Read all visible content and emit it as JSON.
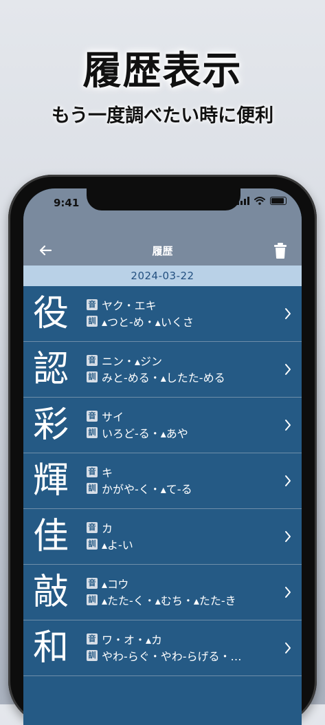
{
  "promo": {
    "headline": "履歴表示",
    "subheadline": "もう一度調べたい時に便利"
  },
  "status_bar": {
    "time": "9:41"
  },
  "nav": {
    "title": "履歴",
    "back_icon": "arrow-left-icon",
    "trash_icon": "trash-icon"
  },
  "date_header": "2024-03-22",
  "badges": {
    "on": "音",
    "kun": "訓"
  },
  "entries": [
    {
      "kanji": "役",
      "on": "ヤク・エキ",
      "kun": "▴つと-め・▴いくさ"
    },
    {
      "kanji": "認",
      "on": "ニン・▴ジン",
      "kun": "みと-める・▴したた-める"
    },
    {
      "kanji": "彩",
      "on": "サイ",
      "kun": "いろど-る・▴あや"
    },
    {
      "kanji": "輝",
      "on": "キ",
      "kun": "かがや-く・▴て-る"
    },
    {
      "kanji": "佳",
      "on": "カ",
      "kun": "▴よ-い"
    },
    {
      "kanji": "敲",
      "on": "▴コウ",
      "kun": "▴たた-く・▴むち・▴たた-き"
    },
    {
      "kanji": "和",
      "on": "ワ・オ・▴カ",
      "kun": "やわ-らぐ・やわ-らげる・…"
    }
  ],
  "colors": {
    "list_bg": "#255a85",
    "date_band": "#b9d1e7",
    "top_bar": "#7a8a9e"
  }
}
